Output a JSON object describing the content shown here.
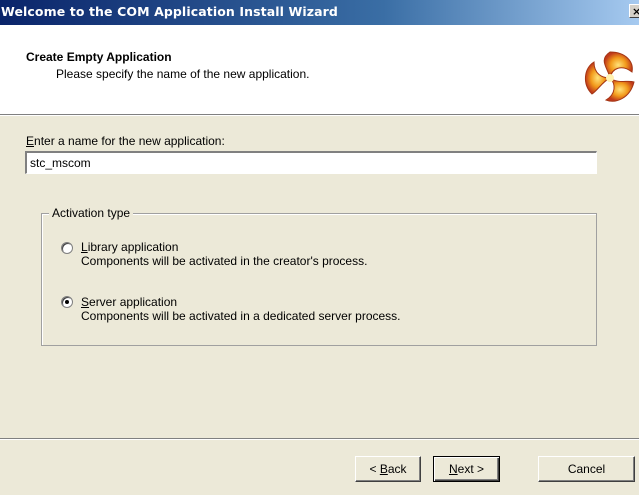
{
  "window": {
    "title": "Welcome to the COM Application Install Wizard",
    "close_glyph": "×"
  },
  "header": {
    "title": "Create Empty Application",
    "subtitle": "Please specify the name of the new application."
  },
  "name_field": {
    "label_mnemonic": "E",
    "label_rest": "nter a name for the new application:",
    "value": "stc_mscom"
  },
  "activation": {
    "legend": "Activation type",
    "options": [
      {
        "label_mnemonic": "L",
        "label_rest": "ibrary application",
        "description": "Components will be activated in the creator's process.",
        "selected": false
      },
      {
        "label_mnemonic": "S",
        "label_rest": "erver application",
        "description": "Components will be activated in a dedicated server process.",
        "selected": true
      }
    ]
  },
  "buttons": {
    "back_prefix": "< ",
    "back_mnemonic": "B",
    "back_rest": "ack",
    "next_mnemonic": "N",
    "next_rest": "ext >",
    "cancel": "Cancel"
  }
}
